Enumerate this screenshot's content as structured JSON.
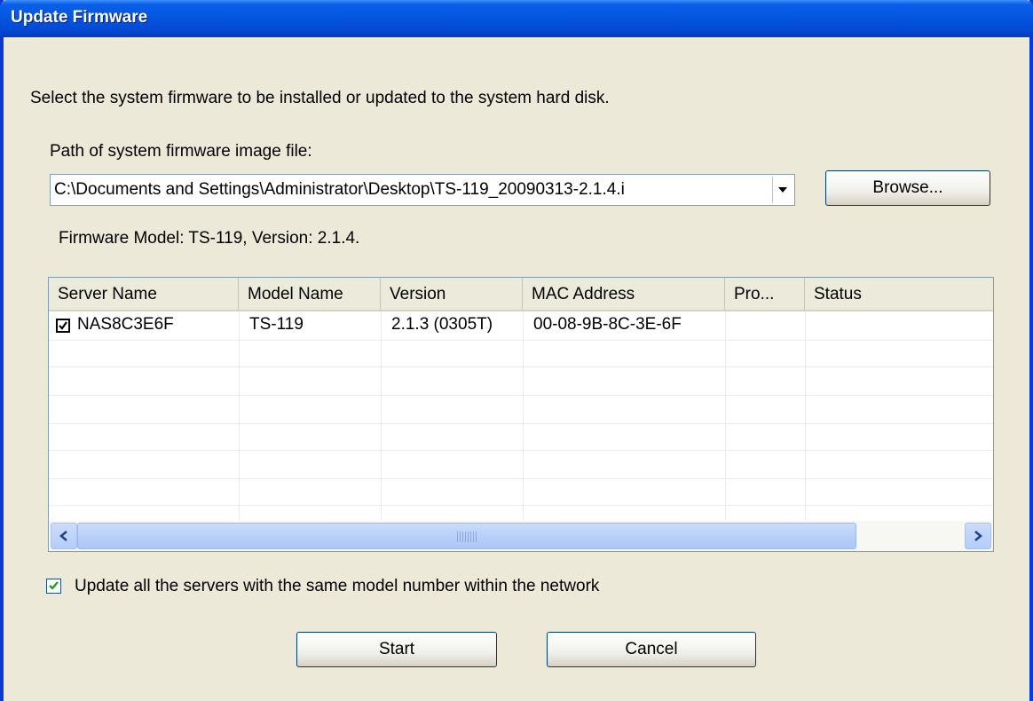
{
  "window": {
    "title": "Update Firmware"
  },
  "instructions": "Select the system firmware to be installed or updated to the system hard disk.",
  "path": {
    "label": "Path of system firmware image file:",
    "value": "C:\\Documents and Settings\\Administrator\\Desktop\\TS-119_20090313-2.1.4.i",
    "browse_label": "Browse..."
  },
  "firmware_info": "Firmware Model: TS-119, Version: 2.1.4.",
  "table": {
    "columns": [
      "Server Name",
      "Model Name",
      "Version",
      "MAC Address",
      "Pro...",
      "Status"
    ],
    "rows": [
      {
        "checked": true,
        "server_name": "NAS8C3E6F",
        "model_name": "TS-119",
        "version": "2.1.3 (0305T)",
        "mac": "00-08-9B-8C-3E-6F",
        "progress": "",
        "status": ""
      }
    ]
  },
  "update_all": {
    "checked": true,
    "label": "Update all the servers with the same model number within the network"
  },
  "buttons": {
    "start": "Start",
    "cancel": "Cancel"
  },
  "colors": {
    "titlebar": "#0556e0",
    "window_bg": "#ece9d8",
    "border": "#0a3ad3"
  }
}
